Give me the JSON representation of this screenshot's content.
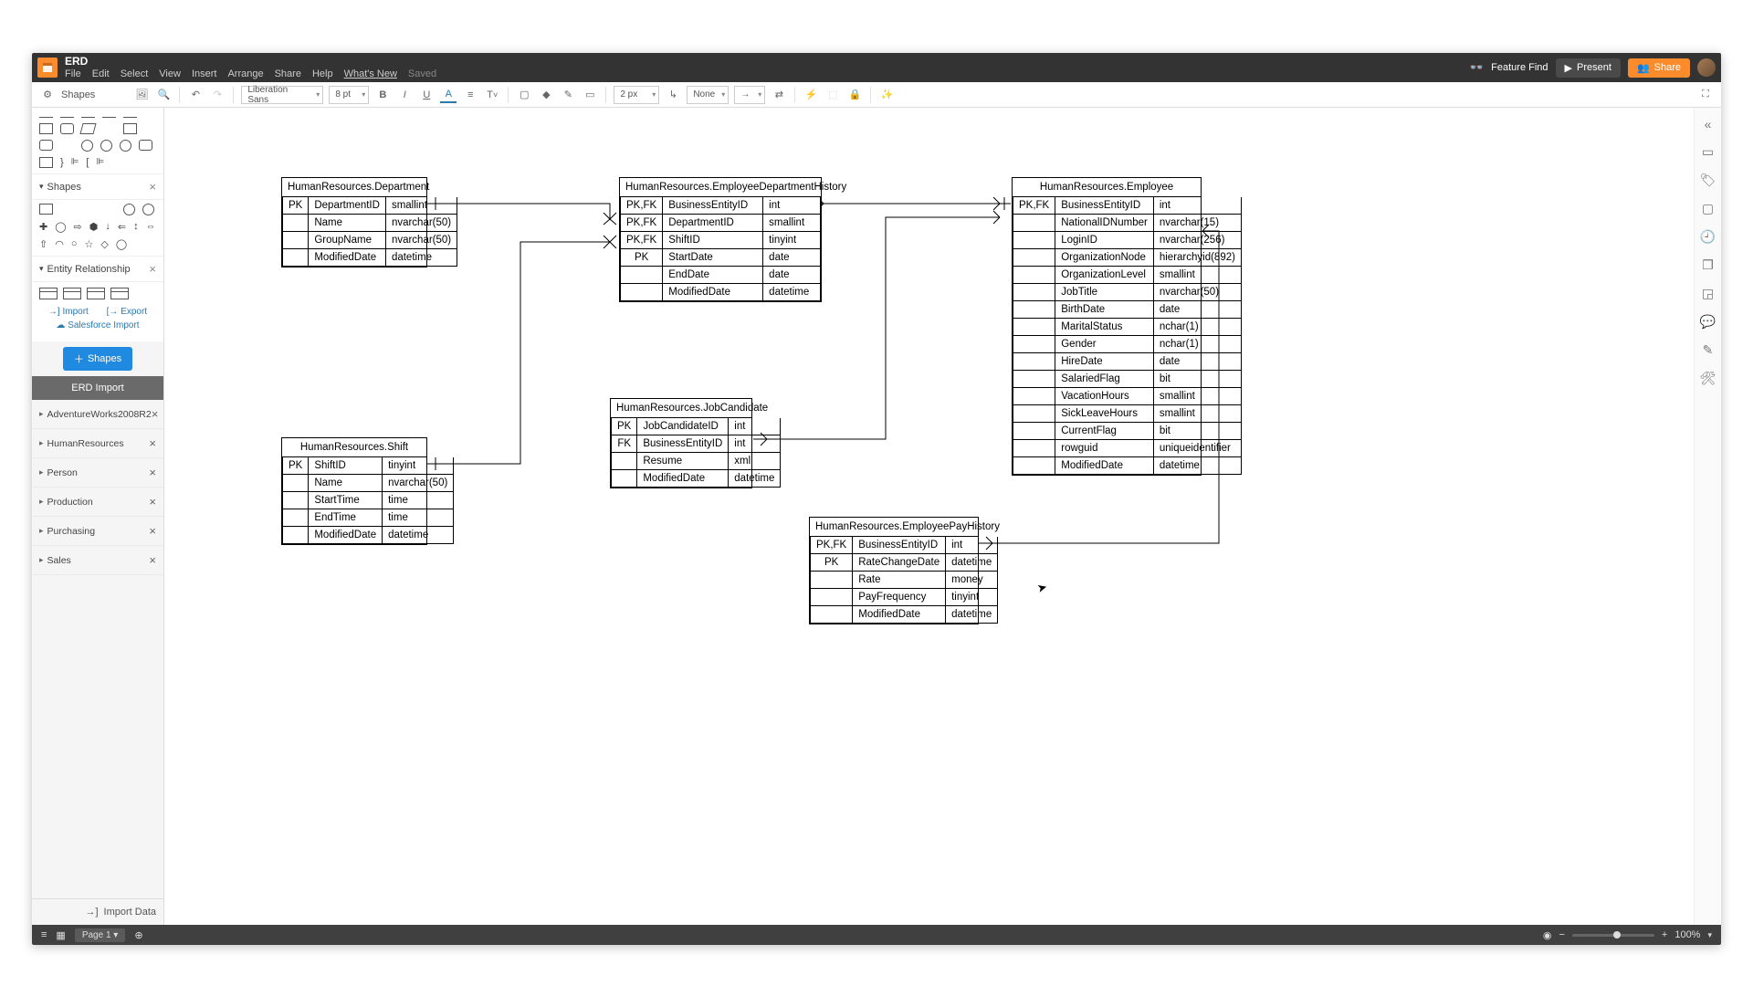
{
  "header": {
    "doc_title": "ERD",
    "menus": [
      "File",
      "Edit",
      "Select",
      "View",
      "Insert",
      "Arrange",
      "Share",
      "Help"
    ],
    "whats_new": "What's New",
    "saved": "Saved",
    "feature_find": "Feature Find",
    "present": "Present",
    "share": "Share"
  },
  "toolbar": {
    "shapes": "Shapes",
    "font": "Liberation Sans",
    "font_size": "8 pt",
    "line_width": "2 px",
    "line_style": "None"
  },
  "sidebar": {
    "shapes_title": "Shapes",
    "er_title": "Entity Relationship",
    "import_lbl": "Import",
    "export_lbl": "Export",
    "salesforce_lbl": "Salesforce Import",
    "shapes_button": "Shapes",
    "erd_import": "ERD Import",
    "schemas": [
      "AdventureWorks2008R2",
      "HumanResources",
      "Person",
      "Production",
      "Purchasing",
      "Sales"
    ],
    "import_data": "Import Data"
  },
  "entities": {
    "department": {
      "title": "HumanResources.Department",
      "rows": [
        {
          "k": "PK",
          "n": "DepartmentID",
          "t": "smallint"
        },
        {
          "k": "",
          "n": "Name",
          "t": "nvarchar(50)"
        },
        {
          "k": "",
          "n": "GroupName",
          "t": "nvarchar(50)"
        },
        {
          "k": "",
          "n": "ModifiedDate",
          "t": "datetime"
        }
      ]
    },
    "edh": {
      "title": "HumanResources.EmployeeDepartmentHistory",
      "rows": [
        {
          "k": "PK,FK",
          "n": "BusinessEntityID",
          "t": "int"
        },
        {
          "k": "PK,FK",
          "n": "DepartmentID",
          "t": "smallint"
        },
        {
          "k": "PK,FK",
          "n": "ShiftID",
          "t": "tinyint"
        },
        {
          "k": "PK",
          "n": "StartDate",
          "t": "date"
        },
        {
          "k": "",
          "n": "EndDate",
          "t": "date"
        },
        {
          "k": "",
          "n": "ModifiedDate",
          "t": "datetime"
        }
      ]
    },
    "employee": {
      "title": "HumanResources.Employee",
      "rows": [
        {
          "k": "PK,FK",
          "n": "BusinessEntityID",
          "t": "int"
        },
        {
          "k": "",
          "n": "NationalIDNumber",
          "t": "nvarchar(15)"
        },
        {
          "k": "",
          "n": "LoginID",
          "t": "nvarchar(256)"
        },
        {
          "k": "",
          "n": "OrganizationNode",
          "t": "hierarchyid(892)"
        },
        {
          "k": "",
          "n": "OrganizationLevel",
          "t": "smallint"
        },
        {
          "k": "",
          "n": "JobTitle",
          "t": "nvarchar(50)"
        },
        {
          "k": "",
          "n": "BirthDate",
          "t": "date"
        },
        {
          "k": "",
          "n": "MaritalStatus",
          "t": "nchar(1)"
        },
        {
          "k": "",
          "n": "Gender",
          "t": "nchar(1)"
        },
        {
          "k": "",
          "n": "HireDate",
          "t": "date"
        },
        {
          "k": "",
          "n": "SalariedFlag",
          "t": "bit"
        },
        {
          "k": "",
          "n": "VacationHours",
          "t": "smallint"
        },
        {
          "k": "",
          "n": "SickLeaveHours",
          "t": "smallint"
        },
        {
          "k": "",
          "n": "CurrentFlag",
          "t": "bit"
        },
        {
          "k": "",
          "n": "rowguid",
          "t": "uniqueidentifier"
        },
        {
          "k": "",
          "n": "ModifiedDate",
          "t": "datetime"
        }
      ]
    },
    "jobcandidate": {
      "title": "HumanResources.JobCandidate",
      "rows": [
        {
          "k": "PK",
          "n": "JobCandidateID",
          "t": "int"
        },
        {
          "k": "FK",
          "n": "BusinessEntityID",
          "t": "int"
        },
        {
          "k": "",
          "n": "Resume",
          "t": "xml"
        },
        {
          "k": "",
          "n": "ModifiedDate",
          "t": "datetime"
        }
      ]
    },
    "shift": {
      "title": "HumanResources.Shift",
      "rows": [
        {
          "k": "PK",
          "n": "ShiftID",
          "t": "tinyint"
        },
        {
          "k": "",
          "n": "Name",
          "t": "nvarchar(50)"
        },
        {
          "k": "",
          "n": "StartTime",
          "t": "time"
        },
        {
          "k": "",
          "n": "EndTime",
          "t": "time"
        },
        {
          "k": "",
          "n": "ModifiedDate",
          "t": "datetime"
        }
      ]
    },
    "payhistory": {
      "title": "HumanResources.EmployeePayHistory",
      "rows": [
        {
          "k": "PK,FK",
          "n": "BusinessEntityID",
          "t": "int"
        },
        {
          "k": "PK",
          "n": "RateChangeDate",
          "t": "datetime"
        },
        {
          "k": "",
          "n": "Rate",
          "t": "money"
        },
        {
          "k": "",
          "n": "PayFrequency",
          "t": "tinyint"
        },
        {
          "k": "",
          "n": "ModifiedDate",
          "t": "datetime"
        }
      ]
    }
  },
  "statusbar": {
    "page": "Page 1",
    "zoom": "100%"
  }
}
